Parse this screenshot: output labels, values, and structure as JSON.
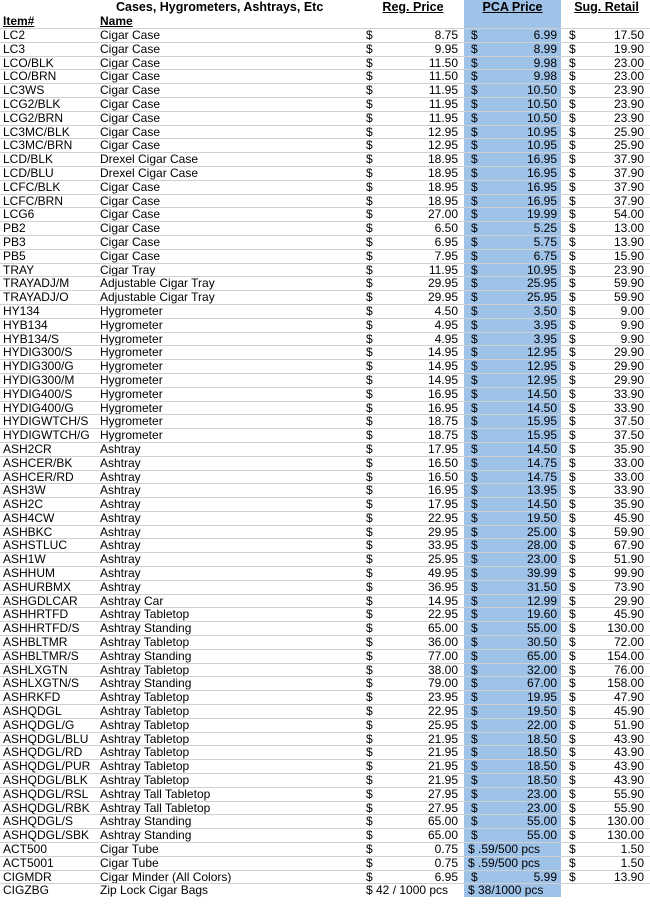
{
  "header": {
    "title": "Cases, Hygrometers, Ashtrays, Etc",
    "reg_price": "Reg. Price",
    "pca_price": "PCA Price",
    "sug_retail": "Sug. Retail",
    "item_col": "Item#",
    "name_col": "Name"
  },
  "currency": "$",
  "rows": [
    {
      "item": "LC2",
      "name": "Cigar Case",
      "reg": "8.75",
      "pca": "6.99",
      "sug": "17.50"
    },
    {
      "item": "LC3",
      "name": "Cigar Case",
      "reg": "9.95",
      "pca": "8.99",
      "sug": "19.90"
    },
    {
      "item": "LCO/BLK",
      "name": "Cigar Case",
      "reg": "11.50",
      "pca": "9.98",
      "sug": "23.00"
    },
    {
      "item": "LCO/BRN",
      "name": "Cigar Case",
      "reg": "11.50",
      "pca": "9.98",
      "sug": "23.00"
    },
    {
      "item": "LC3WS",
      "name": "Cigar Case",
      "reg": "11.95",
      "pca": "10.50",
      "sug": "23.90"
    },
    {
      "item": "LCG2/BLK",
      "name": "Cigar Case",
      "reg": "11.95",
      "pca": "10.50",
      "sug": "23.90"
    },
    {
      "item": "LCG2/BRN",
      "name": "Cigar Case",
      "reg": "11.95",
      "pca": "10.50",
      "sug": "23.90"
    },
    {
      "item": "LC3MC/BLK",
      "name": "Cigar Case",
      "reg": "12.95",
      "pca": "10.95",
      "sug": "25.90"
    },
    {
      "item": "LC3MC/BRN",
      "name": "Cigar Case",
      "reg": "12.95",
      "pca": "10.95",
      "sug": "25.90"
    },
    {
      "item": "LCD/BLK",
      "name": "Drexel Cigar Case",
      "reg": "18.95",
      "pca": "16.95",
      "sug": "37.90"
    },
    {
      "item": "LCD/BLU",
      "name": "Drexel Cigar Case",
      "reg": "18.95",
      "pca": "16.95",
      "sug": "37.90"
    },
    {
      "item": "LCFC/BLK",
      "name": "Cigar Case",
      "reg": "18.95",
      "pca": "16.95",
      "sug": "37.90"
    },
    {
      "item": "LCFC/BRN",
      "name": "Cigar Case",
      "reg": "18.95",
      "pca": "16.95",
      "sug": "37.90"
    },
    {
      "item": "LCG6",
      "name": "Cigar Case",
      "reg": "27.00",
      "pca": "19.99",
      "sug": "54.00"
    },
    {
      "item": "PB2",
      "name": "Cigar Case",
      "reg": "6.50",
      "pca": "5.25",
      "sug": "13.00"
    },
    {
      "item": "PB3",
      "name": "Cigar Case",
      "reg": "6.95",
      "pca": "5.75",
      "sug": "13.90"
    },
    {
      "item": "PB5",
      "name": "Cigar Case",
      "reg": "7.95",
      "pca": "6.75",
      "sug": "15.90"
    },
    {
      "item": "TRAY",
      "name": "Cigar Tray",
      "reg": "11.95",
      "pca": "10.95",
      "sug": "23.90"
    },
    {
      "item": "TRAYADJ/M",
      "name": "Adjustable Cigar Tray",
      "reg": "29.95",
      "pca": "25.95",
      "sug": "59.90"
    },
    {
      "item": "TRAYADJ/O",
      "name": "Adjustable Cigar Tray",
      "reg": "29.95",
      "pca": "25.95",
      "sug": "59.90"
    },
    {
      "item": "HY134",
      "name": "Hygrometer",
      "reg": "4.50",
      "pca": "3.50",
      "sug": "9.00"
    },
    {
      "item": "HYB134",
      "name": "Hygrometer",
      "reg": "4.95",
      "pca": "3.95",
      "sug": "9.90"
    },
    {
      "item": "HYB134/S",
      "name": "Hygrometer",
      "reg": "4.95",
      "pca": "3.95",
      "sug": "9.90"
    },
    {
      "item": "HYDIG300/S",
      "name": "Hygrometer",
      "reg": "14.95",
      "pca": "12.95",
      "sug": "29.90"
    },
    {
      "item": "HYDIG300/G",
      "name": "Hygrometer",
      "reg": "14.95",
      "pca": "12.95",
      "sug": "29.90"
    },
    {
      "item": "HYDIG300/M",
      "name": "Hygrometer",
      "reg": "14.95",
      "pca": "12.95",
      "sug": "29.90"
    },
    {
      "item": "HYDIG400/S",
      "name": "Hygrometer",
      "reg": "16.95",
      "pca": "14.50",
      "sug": "33.90"
    },
    {
      "item": "HYDIG400/G",
      "name": "Hygrometer",
      "reg": "16.95",
      "pca": "14.50",
      "sug": "33.90"
    },
    {
      "item": "HYDIGWTCH/S",
      "name": "Hygrometer",
      "reg": "18.75",
      "pca": "15.95",
      "sug": "37.50"
    },
    {
      "item": "HYDIGWTCH/G",
      "name": "Hygrometer",
      "reg": "18.75",
      "pca": "15.95",
      "sug": "37.50"
    },
    {
      "item": "ASH2CR",
      "name": "Ashtray",
      "reg": "17.95",
      "pca": "14.50",
      "sug": "35.90"
    },
    {
      "item": "ASHCER/BK",
      "name": "Ashtray",
      "reg": "16.50",
      "pca": "14.75",
      "sug": "33.00"
    },
    {
      "item": "ASHCER/RD",
      "name": "Ashtray",
      "reg": "16.50",
      "pca": "14.75",
      "sug": "33.00"
    },
    {
      "item": "ASH3W",
      "name": "Ashtray",
      "reg": "16.95",
      "pca": "13.95",
      "sug": "33.90"
    },
    {
      "item": "ASH2C",
      "name": "Ashtray",
      "reg": "17.95",
      "pca": "14.50",
      "sug": "35.90"
    },
    {
      "item": "ASH4CW",
      "name": "Ashtray",
      "reg": "22.95",
      "pca": "19.50",
      "sug": "45.90"
    },
    {
      "item": "ASHBKC",
      "name": "Ashtray",
      "reg": "29.95",
      "pca": "25.00",
      "sug": "59.90"
    },
    {
      "item": "ASHSTLUC",
      "name": "Ashtray",
      "reg": "33.95",
      "pca": "28.00",
      "sug": "67.90"
    },
    {
      "item": "ASH1W",
      "name": "Ashtray",
      "reg": "25.95",
      "pca": "23.00",
      "sug": "51.90"
    },
    {
      "item": "ASHHUM",
      "name": "Ashtray",
      "reg": "49.95",
      "pca": "39.99",
      "sug": "99.90"
    },
    {
      "item": "ASHURBMX",
      "name": "Ashtray",
      "reg": "36.95",
      "pca": "31.50",
      "sug": "73.90"
    },
    {
      "item": "ASHGDLCAR",
      "name": "Ashtray Car",
      "reg": "14.95",
      "pca": "12.99",
      "sug": "29.90"
    },
    {
      "item": "ASHHRTFD",
      "name": "Ashtray Tabletop",
      "reg": "22.95",
      "pca": "19.60",
      "sug": "45.90"
    },
    {
      "item": "ASHHRTFD/S",
      "name": "Ashtray Standing",
      "reg": "65.00",
      "pca": "55.00",
      "sug": "130.00"
    },
    {
      "item": "ASHBLTMR",
      "name": "Ashtray Tabletop",
      "reg": "36.00",
      "pca": "30.50",
      "sug": "72.00"
    },
    {
      "item": "ASHBLTMR/S",
      "name": "Ashtray Standing",
      "reg": "77.00",
      "pca": "65.00",
      "sug": "154.00"
    },
    {
      "item": "ASHLXGTN",
      "name": "Ashtray Tabletop",
      "reg": "38.00",
      "pca": "32.00",
      "sug": "76.00"
    },
    {
      "item": "ASHLXGTN/S",
      "name": "Ashtray Standing",
      "reg": "79.00",
      "pca": "67.00",
      "sug": "158.00"
    },
    {
      "item": "ASHRKFD",
      "name": "Ashtray Tabletop",
      "reg": "23.95",
      "pca": "19.95",
      "sug": "47.90"
    },
    {
      "item": "ASHQDGL",
      "name": "Ashtray Tabletop",
      "reg": "22.95",
      "pca": "19.50",
      "sug": "45.90"
    },
    {
      "item": "ASHQDGL/G",
      "name": "Ashtray Tabletop",
      "reg": "25.95",
      "pca": "22.00",
      "sug": "51.90"
    },
    {
      "item": "ASHQDGL/BLU",
      "name": "Ashtray Tabletop",
      "reg": "21.95",
      "pca": "18.50",
      "sug": "43.90"
    },
    {
      "item": "ASHQDGL/RD",
      "name": "Ashtray Tabletop",
      "reg": "21.95",
      "pca": "18.50",
      "sug": "43.90"
    },
    {
      "item": "ASHQDGL/PUR",
      "name": "Ashtray Tabletop",
      "reg": "21.95",
      "pca": "18.50",
      "sug": "43.90"
    },
    {
      "item": "ASHQDGL/BLK",
      "name": "Ashtray Tabletop",
      "reg": "21.95",
      "pca": "18.50",
      "sug": "43.90"
    },
    {
      "item": "ASHQDGL/RSL",
      "name": "Ashtray Tall Tabletop",
      "reg": "27.95",
      "pca": "23.00",
      "sug": "55.90"
    },
    {
      "item": "ASHQDGL/RBK",
      "name": "Ashtray Tall Tabletop",
      "reg": "27.95",
      "pca": "23.00",
      "sug": "55.90"
    },
    {
      "item": "ASHQDGL/S",
      "name": "Ashtray Standing",
      "reg": "65.00",
      "pca": "55.00",
      "sug": "130.00"
    },
    {
      "item": "ASHQDGL/SBK",
      "name": "Ashtray Standing",
      "reg": "65.00",
      "pca": "55.00",
      "sug": "130.00"
    },
    {
      "item": "ACT500",
      "name": "Cigar Tube",
      "reg": "0.75",
      "pca_text": "$ .59/500 pcs",
      "sug": "1.50"
    },
    {
      "item": "ACT5001",
      "name": "Cigar Tube",
      "reg": "0.75",
      "pca_text": "$ .59/500 pcs",
      "sug": "1.50"
    },
    {
      "item": "CIGMDR",
      "name": "Cigar Minder (All Colors)",
      "reg": "6.95",
      "pca": "5.99",
      "sug": "13.90"
    },
    {
      "item": "CIGZBG",
      "name": "Zip Lock Cigar Bags",
      "reg_text": "$ 42 / 1000 pcs",
      "pca_text": "$ 38/1000 pcs",
      "sug": ""
    }
  ]
}
